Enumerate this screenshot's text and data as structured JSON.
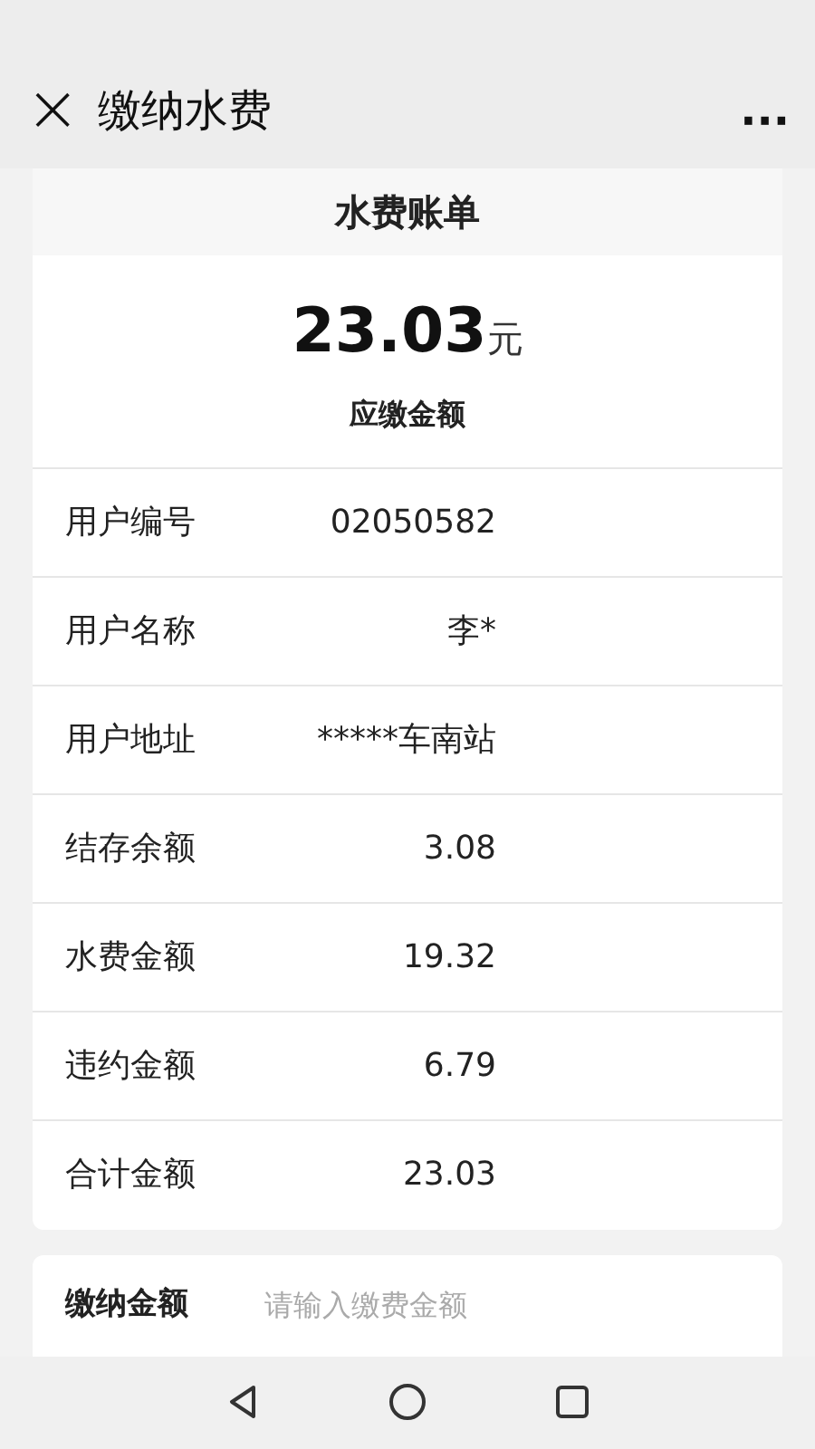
{
  "header": {
    "close": "×",
    "title": "缴纳水费",
    "more": "···"
  },
  "bill": {
    "title": "水费账单",
    "amount": "23.03",
    "unit": "元",
    "amount_label": "应缴金额",
    "rows": [
      {
        "label": "用户编号",
        "value": "02050582"
      },
      {
        "label": "用户名称",
        "value": "李*"
      },
      {
        "label": "用户地址",
        "value": "*****车南站"
      },
      {
        "label": "结存余额",
        "value": "3.08"
      },
      {
        "label": "水费金额",
        "value": "19.32"
      },
      {
        "label": "违约金额",
        "value": "6.79"
      },
      {
        "label": "合计金额",
        "value": "23.03"
      }
    ]
  },
  "payment": {
    "label": "缴纳金额",
    "placeholder": "请输入缴费金额"
  }
}
